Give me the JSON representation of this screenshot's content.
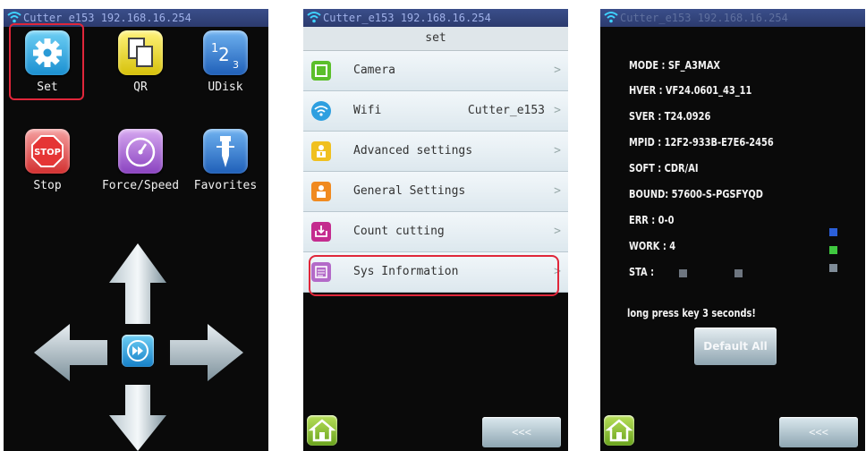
{
  "status": {
    "text": "Cutter_e153 192.168.16.254",
    "text_p1": "Cutter_e153 192.168.16.254"
  },
  "screen1": {
    "apps": [
      {
        "label": "Set",
        "icon": "gear-icon"
      },
      {
        "label": "QR",
        "icon": "copy-icon"
      },
      {
        "label": "UDisk",
        "icon": "udisk-123-icon"
      },
      {
        "label": "Stop",
        "icon": "stop-sign-icon"
      },
      {
        "label": "Force/Speed",
        "icon": "gauge-icon"
      },
      {
        "label": "Favorites",
        "icon": "blade-icon"
      }
    ]
  },
  "screen2": {
    "header": "set",
    "items": [
      {
        "label": "Camera",
        "value": "",
        "color": "#5bbf2a"
      },
      {
        "label": "Wifi",
        "value": "Cutter_e153",
        "color": "#2e9fe0"
      },
      {
        "label": "Advanced settings",
        "value": "",
        "color": "#f0c020"
      },
      {
        "label": "General Settings",
        "value": "",
        "color": "#f08a20"
      },
      {
        "label": "Count cutting",
        "value": "",
        "color": "#c42c8f"
      },
      {
        "label": "Sys Information",
        "value": "",
        "color": "#b36ac8"
      }
    ],
    "chevron": ">",
    "back_label": "<<<"
  },
  "screen3": {
    "lines": [
      "MODE : SF_A3MAX",
      "HVER : VF24.0601_43_11",
      "SVER : T24.0926",
      "MPID : 12F2-933B-E7E6-2456",
      "SOFT : CDR/AI",
      "BOUND: 57600-S-PGSFYQD",
      "ERR  :  0-0",
      "WORK :  4",
      "STA  :"
    ],
    "note": "long press key 3 seconds!",
    "default_label": "Default All",
    "back_label": "<<<"
  },
  "colors": {
    "highlight": "#e0263a",
    "status_bg": "#2c3b6e"
  }
}
